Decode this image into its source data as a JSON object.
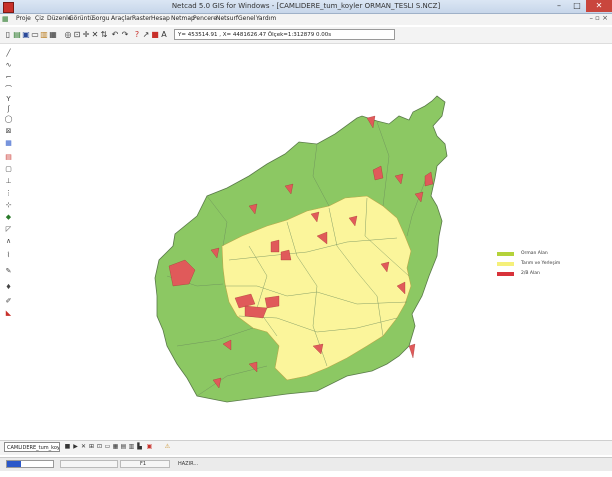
{
  "window": {
    "title": "Netcad 5.0 GIS for Windows - [CAMLIDERE_tum_koyler ORMAN_TESLI S.NCZ]"
  },
  "menu": [
    "Proje",
    "Çiz",
    "Düzenle",
    "Görüntü",
    "Sorgu",
    "Araçlar",
    "Raster",
    "Hesap",
    "Netmap",
    "Pencere",
    "Netsurf",
    "Genel",
    "Yardım"
  ],
  "toolbar": {
    "coordinates": "Y= 453514.91 , X= 4481626.47 Ölçek=1:312879 0.00s",
    "icons": [
      "new-file-icon",
      "open-folder-icon",
      "save-icon",
      "folder-icon",
      "layers-icon",
      "zoom-icon",
      "pan-icon",
      "crosshair-icon",
      "scissors-icon",
      "snap-icon",
      "undo-icon",
      "redo-icon",
      "help-icon",
      "edit-line-icon",
      "color-icon",
      "print-icon"
    ]
  },
  "left_tools": [
    "line-icon",
    "curve-icon",
    "polyline-icon",
    "arc-icon",
    "text-icon",
    "spline-icon",
    "circle-icon",
    "rect-icon",
    "select-icon",
    "fill-icon",
    "block-icon",
    "point-icon",
    "node-icon",
    "measure-icon",
    "triangle-icon",
    "pencil-icon",
    "marker-icon",
    "brush-icon"
  ],
  "legend": [
    {
      "label": "Orman Alan",
      "color": "#b4d23a"
    },
    {
      "label": "Tarım ve Yerleşim",
      "color": "#f5f07a"
    },
    {
      "label": "2/B Alan",
      "color": "#d8323a"
    }
  ],
  "colors": {
    "forest": "#8cc863",
    "agri": "#fbf59b",
    "b2": "#e05a5a",
    "border": "#5a7a4a"
  },
  "layerbar": {
    "layer_name": "CAMLIDERE_tum_koyler",
    "icons": [
      "stop-icon",
      "play-icon",
      "delete-icon",
      "grid-icon",
      "select-icon",
      "rect-icon",
      "layer-icon",
      "table-icon",
      "warning-icon"
    ]
  },
  "status": {
    "progress": 0.3,
    "field": "F1",
    "message": "HAZIR..."
  }
}
